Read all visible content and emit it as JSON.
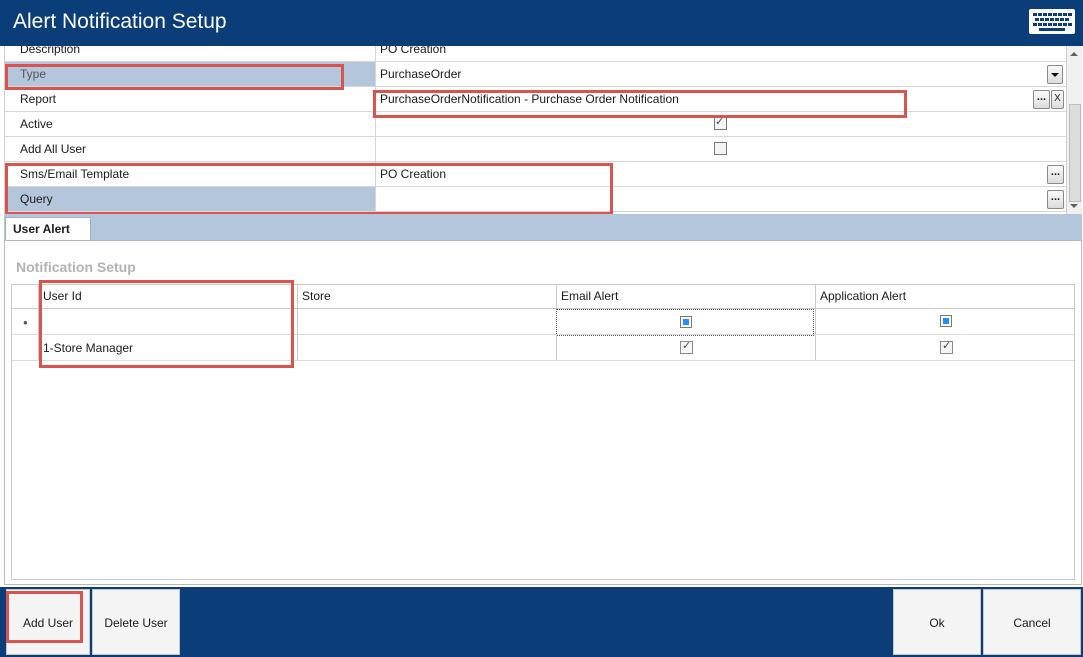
{
  "window": {
    "title": "Alert Notification Setup",
    "keyboard_icon": "keyboard-icon"
  },
  "properties": [
    {
      "label": "Description",
      "value": "PO Creation"
    },
    {
      "label": "Type",
      "value": "PurchaseOrder"
    },
    {
      "label": "Report",
      "value": "PurchaseOrderNotification - Purchase Order Notification"
    },
    {
      "label": "Active",
      "value": "",
      "checked": true
    },
    {
      "label": "Add All User",
      "value": "",
      "checked": false
    },
    {
      "label": "Sms/Email Template",
      "value": "PO Creation"
    },
    {
      "label": "Query",
      "value": ""
    }
  ],
  "buttons": {
    "ellipsis": "...",
    "clear": "X"
  },
  "tabs": [
    {
      "label": "User Alert"
    }
  ],
  "notification": {
    "section_title": "Notification Setup",
    "columns": [
      "User Id",
      "Store",
      "Email Alert",
      "Application Alert"
    ],
    "rows": [
      {
        "user_id": "1-Store Manager",
        "store": "",
        "email_alert": true,
        "application_alert": true
      }
    ]
  },
  "footer": {
    "add_user": "Add User",
    "delete_user": "Delete User",
    "ok": "Ok",
    "cancel": "Cancel"
  },
  "colors": {
    "titlebar": "#0b3d78",
    "selected_row": "#b4c6dc",
    "highlight": "#d9534f"
  }
}
